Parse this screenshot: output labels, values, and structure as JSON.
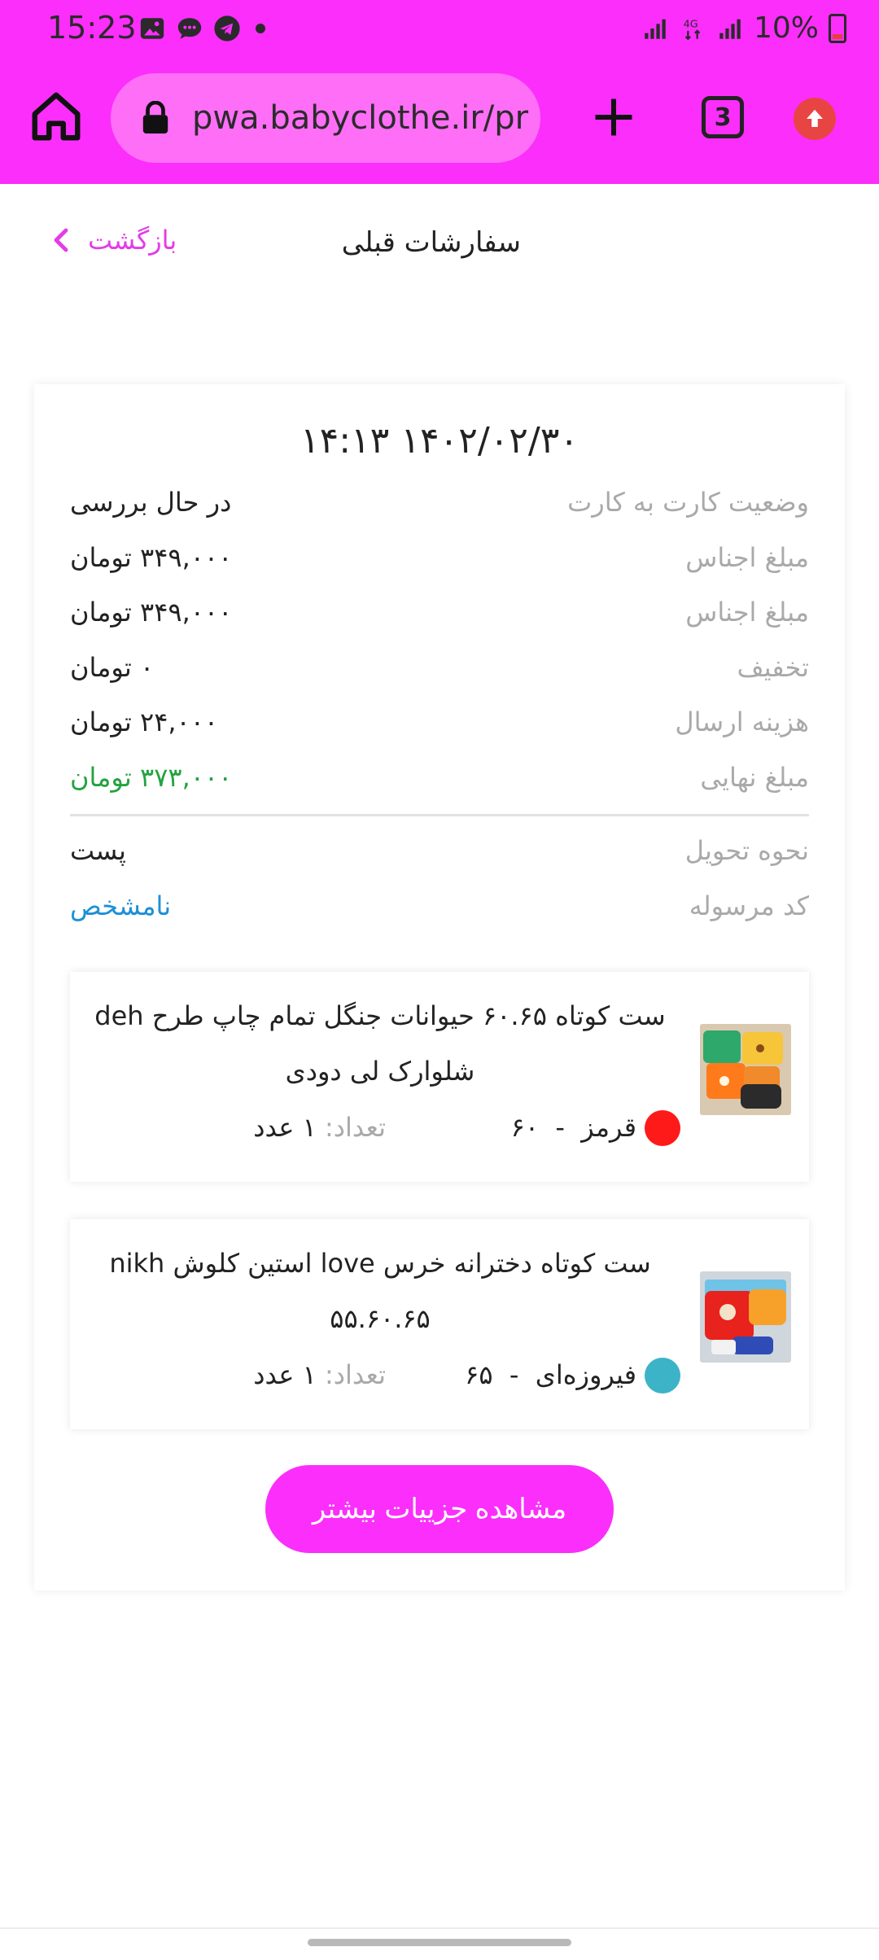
{
  "status_bar": {
    "time": "15:23",
    "battery": "10%"
  },
  "browser": {
    "url": "pwa.babyclothe.ir/pr",
    "tab_count": "3"
  },
  "header": {
    "title": "سفارشات قبلی",
    "back_label": "بازگشت"
  },
  "order": {
    "date": "۱۴۰۲/۰۲/۳۰ ۱۴:۱۳",
    "rows": [
      {
        "label": "وضعیت کارت به کارت",
        "value": "در حال بررسی"
      },
      {
        "label": "مبلغ اجناس",
        "value": "۳۴۹,۰۰۰ تومان"
      },
      {
        "label": "مبلغ اجناس",
        "value": "۳۴۹,۰۰۰ تومان"
      },
      {
        "label": "تخفیف",
        "value": "۰ تومان"
      },
      {
        "label": "هزینه ارسال",
        "value": "۲۴,۰۰۰ تومان"
      },
      {
        "label": "مبلغ نهایی",
        "value": "۳۷۳,۰۰۰ تومان"
      }
    ],
    "delivery": {
      "label": "نحوه تحویل",
      "value": "پست"
    },
    "tracking": {
      "label": "کد مرسوله",
      "value": "نامشخص"
    },
    "items": [
      {
        "title": "ست کوتاه ۶۰.۶۵ حیوانات جنگل تمام چاپ طرح deh شلوارک لی دودی",
        "color_name": "قرمز",
        "size": "۶۰",
        "qty_label": "تعداد:",
        "qty_value": "۱ عدد",
        "swatch_color": "#ff1a1a"
      },
      {
        "title": "ست کوتاه دخترانه خرس love استین کلوش nikh ۵۵.۶۰.۶۵",
        "color_name": "فیروزه‌ای",
        "size": "۶۵",
        "qty_label": "تعداد:",
        "qty_value": "۱ عدد",
        "swatch_color": "#3cb3c6"
      }
    ],
    "details_button": "مشاهده جزییات بیشتر"
  },
  "colors": {
    "accent": "#fb2efb",
    "final_price": "#23a341",
    "tracking": "#1e90d6"
  }
}
